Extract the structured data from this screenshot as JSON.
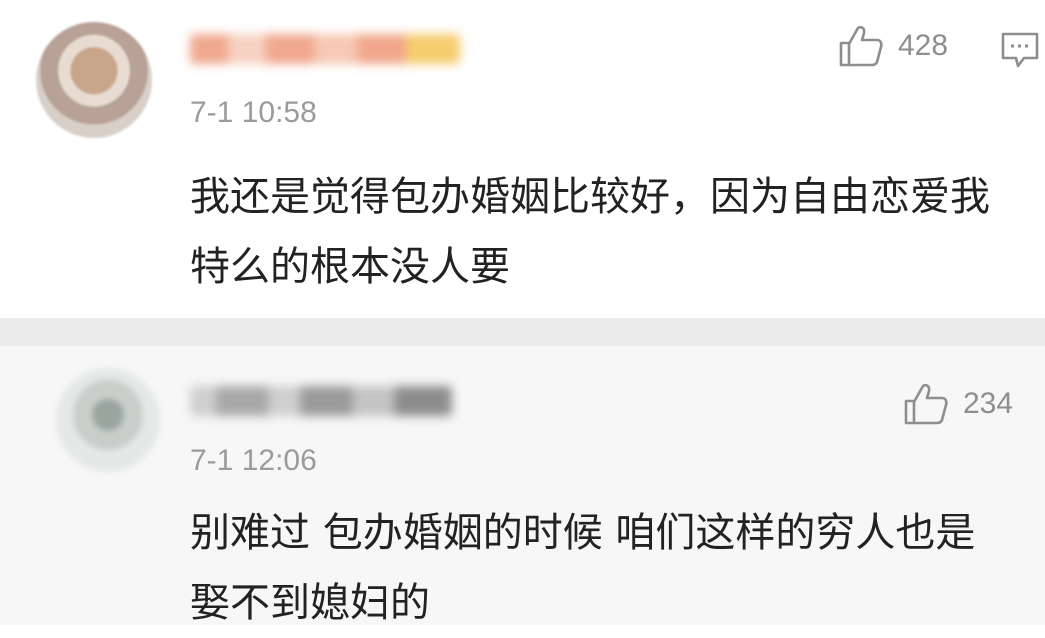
{
  "comments": [
    {
      "time": "7-1 10:58",
      "likes": "428",
      "text": "我还是觉得包办婚姻比较好，因为自由恋爱我特么的根本没人要"
    },
    {
      "time": "7-1 12:06",
      "likes": "234",
      "text": "别难过 包办婚姻的时候 咱们这样的穷人也是娶不到媳妇的"
    }
  ],
  "icons": {
    "like": "thumbs-up-icon",
    "reply": "comment-icon"
  },
  "colors": {
    "text": "#222222",
    "meta": "#9b9b9b",
    "separator": "#ebebeb",
    "reply_bg": "#f7f7f7"
  }
}
